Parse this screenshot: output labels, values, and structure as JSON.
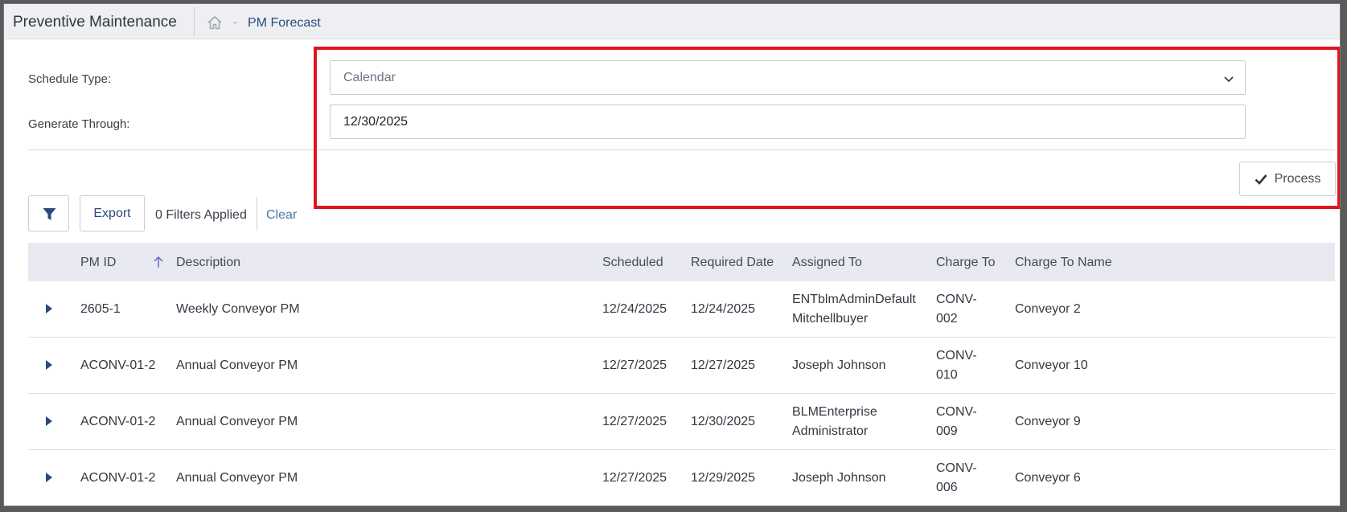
{
  "header": {
    "app_title": "Preventive Maintenance",
    "breadcrumb_sep": "-",
    "breadcrumb_current": "PM Forecast"
  },
  "form": {
    "schedule_type_label": "Schedule Type:",
    "schedule_type_value": "Calendar",
    "generate_through_label": "Generate Through:",
    "generate_through_value": "12/30/2025",
    "process_label": "Process"
  },
  "toolbar": {
    "export_label": "Export",
    "filters_applied": "0 Filters Applied",
    "clear_label": "Clear"
  },
  "table": {
    "columns": [
      "PM ID",
      "Description",
      "Scheduled",
      "Required Date",
      "Assigned To",
      "Charge To",
      "Charge To Name"
    ],
    "rows": [
      {
        "pm_id": "2605-1",
        "description": "Weekly Conveyor PM",
        "scheduled": "12/24/2025",
        "required_date": "12/24/2025",
        "assigned_to": [
          "ENTblmAdminDefault",
          "Mitchellbuyer"
        ],
        "charge_to": [
          "CONV-",
          "002"
        ],
        "charge_to_name": "Conveyor 2"
      },
      {
        "pm_id": "ACONV-01-2",
        "description": "Annual Conveyor PM",
        "scheduled": "12/27/2025",
        "required_date": "12/27/2025",
        "assigned_to": [
          "Joseph Johnson"
        ],
        "charge_to": [
          "CONV-",
          "010"
        ],
        "charge_to_name": "Conveyor 10"
      },
      {
        "pm_id": "ACONV-01-2",
        "description": "Annual Conveyor PM",
        "scheduled": "12/27/2025",
        "required_date": "12/30/2025",
        "assigned_to": [
          "BLMEnterprise",
          "Administrator"
        ],
        "charge_to": [
          "CONV-",
          "009"
        ],
        "charge_to_name": "Conveyor 9"
      },
      {
        "pm_id": "ACONV-01-2",
        "description": "Annual Conveyor PM",
        "scheduled": "12/27/2025",
        "required_date": "12/29/2025",
        "assigned_to": [
          "Joseph Johnson"
        ],
        "charge_to": [
          "CONV-",
          "006"
        ],
        "charge_to_name": "Conveyor 6"
      }
    ]
  },
  "colors": {
    "accent": "#2b4a7a",
    "highlight": "#e0151c",
    "header_bg": "#e9e9f2",
    "topbar_bg": "#eeeff3"
  },
  "icons": {
    "home": "home-icon",
    "chevron": "chevron-down-icon",
    "check": "check-icon",
    "filter": "funnel-icon",
    "sort": "sort-ascending-icon",
    "expand": "caret-right-icon"
  }
}
